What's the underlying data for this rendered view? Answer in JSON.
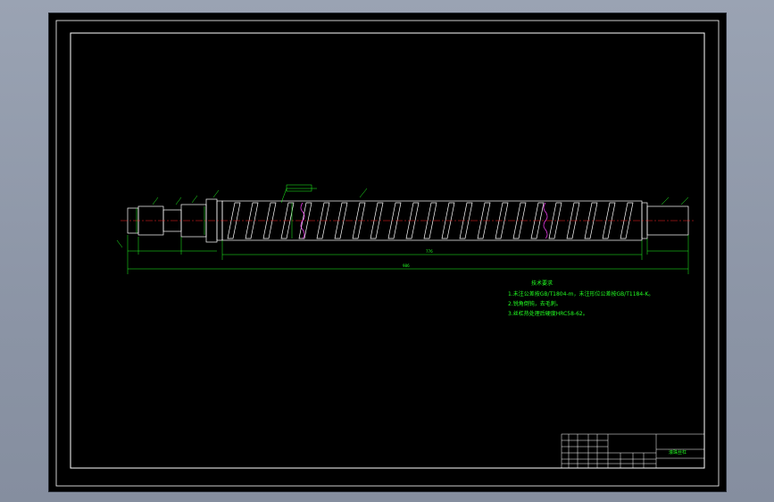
{
  "drawing": {
    "background": "#000000",
    "line_color": "#ffffff",
    "dim_color": "#22ff22",
    "center_line_color": "#ff2020",
    "thread_break_color": "#ff40ff",
    "outer_frame": "rectangle",
    "inner_frame": "rectangle"
  },
  "tech_requirements": {
    "title": "技术要求",
    "lines": [
      "1.未注公差按GB/T1804-m，未注形位公差按GB/T1184-K。",
      "2.锐角倒钝，去毛刺。",
      "3.丝杠热处理后硬度HRC58-62。"
    ]
  },
  "dimensions": {
    "overall_length": "986",
    "thread_length": "776"
  },
  "title_block": {
    "name": "滚珠丝杠"
  }
}
